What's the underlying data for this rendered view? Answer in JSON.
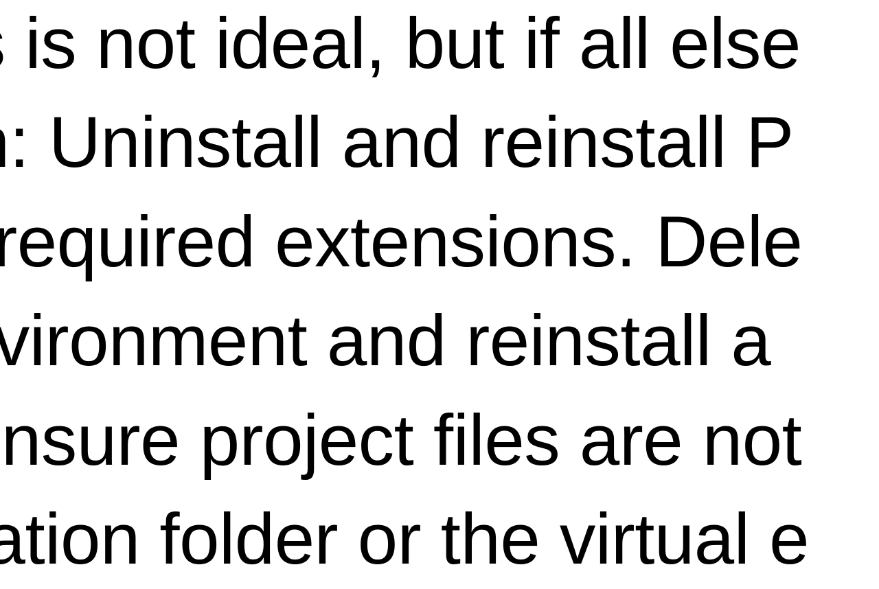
{
  "document": {
    "lines": [
      "his is not ideal, but if all else",
      "ion: Uninstall and reinstall P",
      "th required extensions. Dele",
      " environment and reinstall a",
      ". Ensure project files are not",
      "allation folder or the virtual e"
    ]
  }
}
